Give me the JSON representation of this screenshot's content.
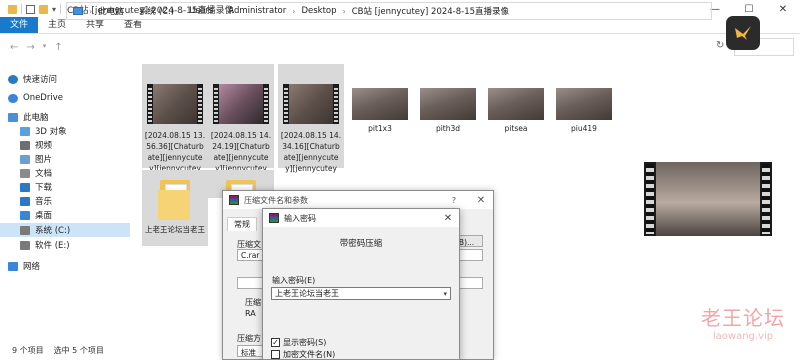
{
  "window": {
    "title": "CB站 [jennycutey] 2024-8-15直播录像",
    "controls": [
      "—",
      "☐",
      "✕"
    ]
  },
  "ribbon": {
    "tabs": [
      "文件",
      "主页",
      "共享",
      "查看"
    ]
  },
  "address": {
    "nav": [
      "←",
      "→",
      "↑"
    ],
    "segments": [
      "此电脑",
      "系统 (C:)",
      "Users",
      "Administrator",
      "Desktop",
      "CB站 [jennycutey] 2024-8-15直播录像"
    ],
    "refresh": "↻"
  },
  "sidebar": {
    "items": [
      {
        "label": "快速访问",
        "icon": "star-icon",
        "color": "#2b78c5"
      },
      {
        "label": "OneDrive",
        "icon": "cloud-icon",
        "color": "#3a86d6"
      },
      {
        "label": "此电脑",
        "icon": "pc-icon",
        "color": "#4a90d9"
      },
      {
        "label": "3D 对象",
        "icon": "cube-icon",
        "color": "#5aa0e0"
      },
      {
        "label": "视频",
        "icon": "video-icon",
        "color": "#6f6f6f"
      },
      {
        "label": "图片",
        "icon": "picture-icon",
        "color": "#6a9ed6"
      },
      {
        "label": "文档",
        "icon": "document-icon",
        "color": "#8b8b8b"
      },
      {
        "label": "下载",
        "icon": "download-icon",
        "color": "#2b78c5"
      },
      {
        "label": "音乐",
        "icon": "music-icon",
        "color": "#2b78c5"
      },
      {
        "label": "桌面",
        "icon": "desktop-icon",
        "color": "#3a86d6"
      },
      {
        "label": "系统 (C:)",
        "icon": "drive-icon",
        "color": "#7a7a7a"
      },
      {
        "label": "软件 (E:)",
        "icon": "drive-icon",
        "color": "#7a7a7a"
      },
      {
        "label": "网络",
        "icon": "network-icon",
        "color": "#3a86d6"
      }
    ]
  },
  "files": {
    "videos": [
      "[2024.08.15 13.56.36][Chaturbate][jennycutey][jennycutey",
      "[2024.08.15 14.24.19][Chaturbate][jennycutey][jennycutey",
      "[2024.08.15 14.34.16][Chaturbate][jennycutey][jennycutey"
    ],
    "images": [
      "pit1x3",
      "pith3d",
      "pitsea",
      "piu419"
    ],
    "folders": [
      "上老王论坛当老王",
      ""
    ]
  },
  "status": {
    "count": "9 个项目",
    "selected": "选中 5 个项目"
  },
  "archive_dialog": {
    "title": "压缩文件名和参数",
    "help": "?",
    "close": "✕",
    "tab": "常规",
    "label_name": "压缩文",
    "name_value": "C.rar",
    "label_update": "压缩",
    "label_method": "压缩方",
    "method_value": "标准",
    "browse": "浏览(B)...",
    "radio_label": "RA"
  },
  "password_dialog": {
    "title": "输入密码",
    "close": "✕",
    "header": "带密码压缩",
    "label": "输入密码(E)",
    "value": "上老王论坛当老王",
    "show_password": "显示密码(S)",
    "encrypt_names": "加密文件名(N)"
  },
  "watermark": {
    "text": "老王论坛",
    "site": "laowang.vip"
  }
}
